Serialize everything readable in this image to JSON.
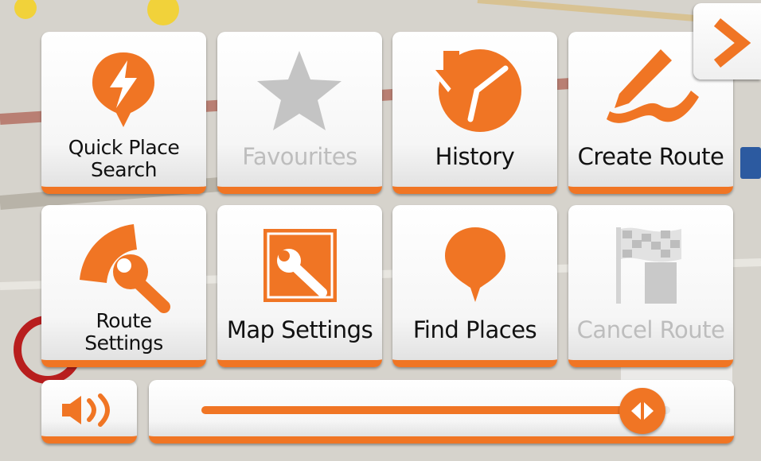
{
  "menu": {
    "tiles": [
      {
        "id": "quick-place-search",
        "line1": "Quick Place",
        "line2": "Search",
        "enabled": true,
        "icon": "lightning-pin-icon"
      },
      {
        "id": "favourites",
        "label": "Favourites",
        "enabled": false,
        "icon": "star-icon"
      },
      {
        "id": "history",
        "label": "History",
        "enabled": true,
        "icon": "clock-history-icon"
      },
      {
        "id": "create-route",
        "label": "Create Route",
        "enabled": true,
        "icon": "pen-route-icon"
      },
      {
        "id": "route-settings",
        "line1": "Route",
        "line2": "Settings",
        "enabled": true,
        "icon": "route-wrench-icon"
      },
      {
        "id": "map-settings",
        "label": "Map Settings",
        "enabled": true,
        "icon": "map-wrench-icon"
      },
      {
        "id": "find-places",
        "label": "Find Places",
        "enabled": true,
        "icon": "location-pin-icon"
      },
      {
        "id": "cancel-route",
        "label": "Cancel Route",
        "enabled": false,
        "icon": "checkered-flag-icon"
      }
    ]
  },
  "next_page": {
    "icon": "chevron-right-icon"
  },
  "volume": {
    "icon": "speaker-icon",
    "level": 0.94
  },
  "colors": {
    "accent": "#f07524",
    "disabled": "#bdbdbd",
    "text": "#111111"
  }
}
